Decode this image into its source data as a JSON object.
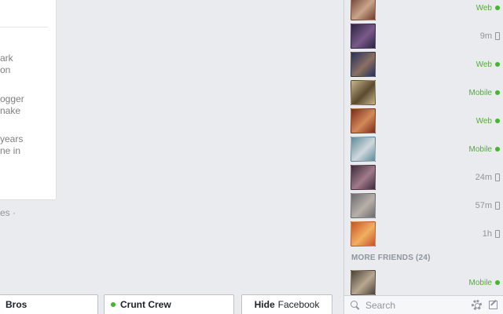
{
  "feed": {
    "snippets": [
      "ark",
      "on",
      "ogger",
      "nake",
      "years",
      "ne in"
    ],
    "below_text": "es ·"
  },
  "sidebar": {
    "friends": [
      {
        "status": "Web",
        "type": "web",
        "colors": [
          "#6b3a2e",
          "#c9a58a"
        ]
      },
      {
        "status": "9m",
        "type": "time",
        "colors": [
          "#2a2440",
          "#7a5a8a"
        ]
      },
      {
        "status": "Web",
        "type": "web",
        "colors": [
          "#24305e",
          "#8a7060"
        ]
      },
      {
        "status": "Mobile",
        "type": "web",
        "colors": [
          "#c9b58a",
          "#5a4a30"
        ]
      },
      {
        "status": "Web",
        "type": "web",
        "colors": [
          "#7a2a1a",
          "#d28a5a"
        ]
      },
      {
        "status": "Mobile",
        "type": "web",
        "colors": [
          "#5a8a9a",
          "#d0d8dc"
        ]
      },
      {
        "status": "24m",
        "type": "time",
        "colors": [
          "#3a2a3a",
          "#a07a8a"
        ]
      },
      {
        "status": "57m",
        "type": "time",
        "colors": [
          "#6a6a70",
          "#b8b0a8"
        ]
      },
      {
        "status": "1h",
        "type": "time",
        "colors": [
          "#c8502a",
          "#f0b060"
        ]
      }
    ],
    "more_header": "MORE FRIENDS (24)",
    "more_friend": {
      "status": "Mobile",
      "type": "web",
      "colors": [
        "#4a4038",
        "#b8a890"
      ]
    },
    "search_placeholder": "Search"
  },
  "chat_tabs": {
    "tab1": "Bros",
    "tab2": "Crunt Crew",
    "hide_bold": "Hide",
    "hide_light": "Facebook"
  },
  "colors": {
    "online": "#42b72a",
    "muted": "#90949c"
  }
}
